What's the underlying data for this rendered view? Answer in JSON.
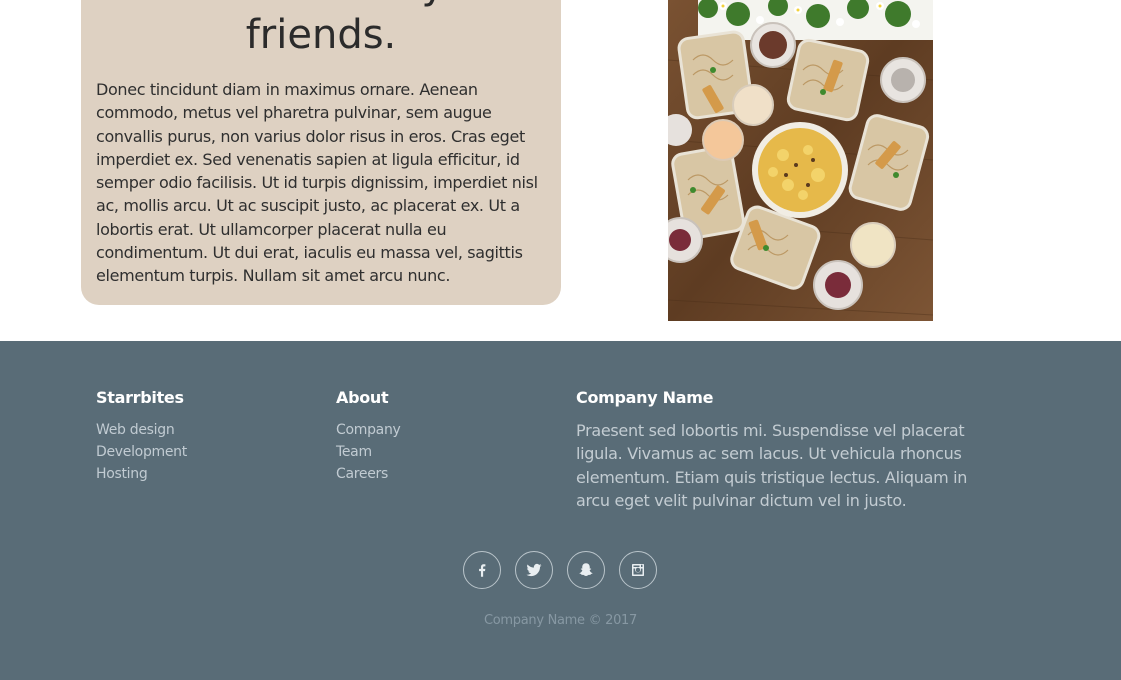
{
  "feature": {
    "title": "Have fun with your friends.",
    "text": "Donec tincidunt diam in maximus ornare. Aenean commodo, metus vel pharetra pulvinar, sem augue convallis purus, non varius dolor risus in eros. Cras eget imperdiet ex. Sed venenatis sapien at ligula efficitur, id semper odio facilisis. Ut id turpis dignissim, imperdiet nisl ac, mollis arcu. Ut ac suscipit justo, ac placerat ex. Ut a lobortis erat. Ut ullamcorper placerat nulla eu condimentum. Ut dui erat, iaculis eu massa vel, sagittis elementum turpis. Nullam sit amet arcu nunc."
  },
  "footer": {
    "services": {
      "heading": "Starrbites",
      "links": [
        "Web design",
        "Development",
        "Hosting"
      ]
    },
    "about": {
      "heading": "About",
      "links": [
        "Company",
        "Team",
        "Careers"
      ]
    },
    "company": {
      "heading": "Company Name",
      "text": "Praesent sed lobortis mi. Suspendisse vel placerat ligula. Vivamus ac sem lacus. Ut vehicula rhoncus elementum. Etiam quis tristique lectus. Aliquam in arcu eget velit pulvinar dictum vel in justo."
    },
    "social": [
      "facebook-icon",
      "twitter-icon",
      "snapchat-icon",
      "instagram-icon"
    ],
    "copyright": "Company Name © 2017"
  },
  "colors": {
    "card_bg": "#ded1c2",
    "footer_bg": "#596c77"
  }
}
